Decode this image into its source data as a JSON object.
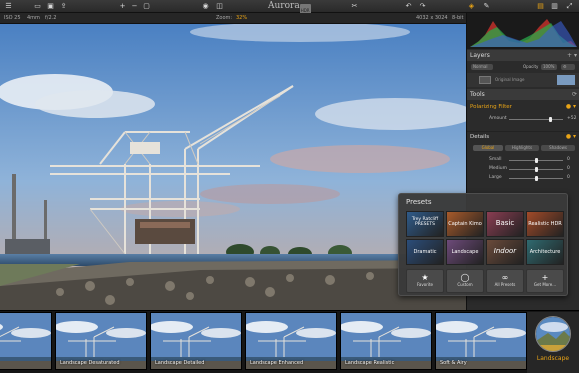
{
  "app": {
    "title": "Aurora",
    "badge": "HDR"
  },
  "toolbar": {
    "icons_left": [
      "menu-icon",
      "folder-open-icon",
      "save-icon",
      "share-icon",
      "zoom-in-icon",
      "zoom-out-icon",
      "fit-icon"
    ],
    "icons_center": [
      "eye-icon",
      "compare-icon",
      "crop-icon"
    ],
    "icons_right": [
      "undo-icon",
      "redo-icon",
      "layers-icon",
      "brush-icon",
      "panel-layout-icon",
      "fullscreen-icon"
    ],
    "accent": "#e9a416"
  },
  "infobar": {
    "iso": "ISO 25",
    "focal": "4mm",
    "aperture": "f/2.2",
    "zoom_label": "Zoom:",
    "zoom_value": "32%",
    "dimensions": "4032 x 3024",
    "bit_depth": "8-bit"
  },
  "layers": {
    "title": "Layers",
    "blend": "Normal",
    "opacity_label": "Opacity",
    "opacity_value": "100%",
    "layer_name": "Original Image"
  },
  "tools": {
    "title": "Tools",
    "filter_title": "Polarizing Filter",
    "amount_label": "Amount",
    "amount_value": "+52",
    "amount_level": 0.76,
    "details": {
      "title": "Details",
      "tabs": [
        "Global",
        "Highlights",
        "Shadows"
      ],
      "rows": [
        {
          "label": "Small",
          "value": "0",
          "level": 0.5
        },
        {
          "label": "Medium",
          "value": "0",
          "level": 0.5
        },
        {
          "label": "Large",
          "value": "0",
          "level": 0.5
        }
      ]
    }
  },
  "presets": {
    "title": "Presets",
    "tiles": [
      {
        "label": "Trey Ratcliff PRESETS",
        "color": "#2f5b8a"
      },
      {
        "label": "Captain Kimo",
        "color": "#a85a2a"
      },
      {
        "label": "Basic",
        "color": "#8a3d52"
      },
      {
        "label": "Realistic HDR",
        "color": "#a24a28"
      },
      {
        "label": "Dramatic",
        "color": "#2b4d7a"
      },
      {
        "label": "Landscape",
        "color": "#6d4a7a"
      },
      {
        "label": "Indoor",
        "color": "#6a4a3a"
      },
      {
        "label": "Architecture",
        "color": "#2f6a70"
      }
    ],
    "categories": [
      {
        "label": "Favorite",
        "icon": "★"
      },
      {
        "label": "Custom",
        "icon": "◯"
      },
      {
        "label": "All Presets",
        "icon": "∞"
      },
      {
        "label": "Get More...",
        "icon": "+"
      }
    ]
  },
  "filmstrip": {
    "thumbs": [
      "",
      "Landscape Desaturated",
      "Landscape Detailed",
      "Landscape Enhanced",
      "Landscape Realistic",
      "Soft & Airy"
    ],
    "category": "Landscape"
  }
}
